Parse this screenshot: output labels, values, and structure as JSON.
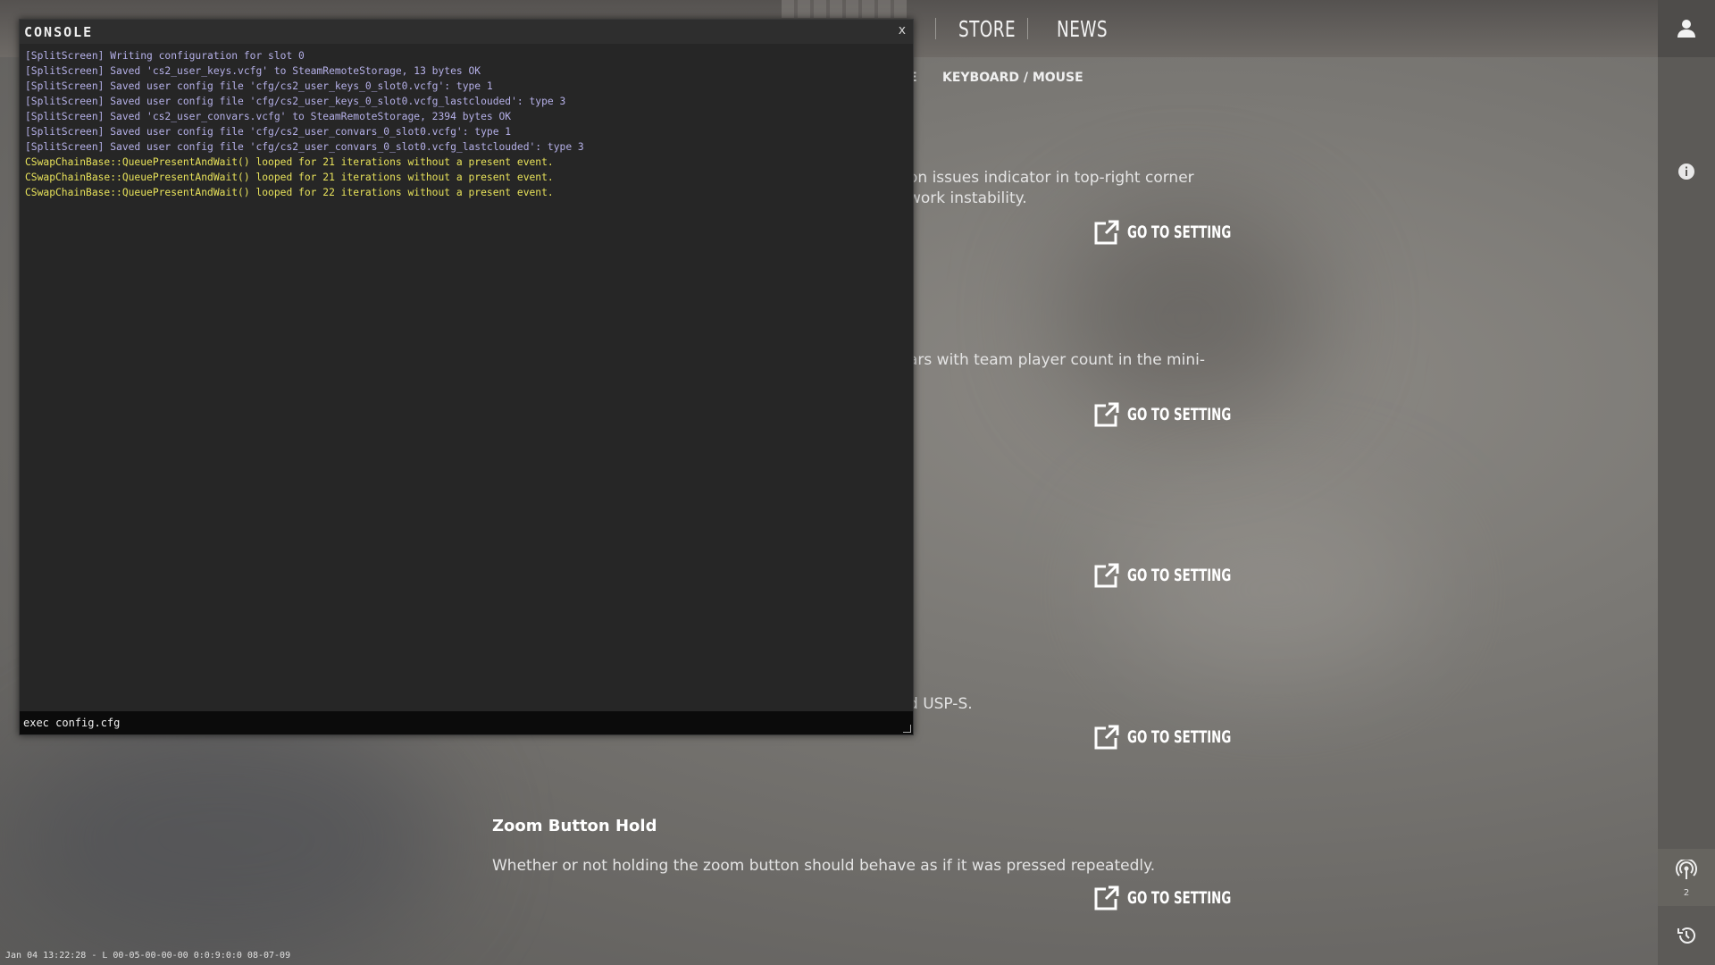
{
  "topnav": {
    "items": [
      {
        "label": "STORE"
      },
      {
        "label": "NEWS"
      }
    ]
  },
  "subnav": {
    "partial_label": "E",
    "active_label": "KEYBOARD / MOUSE"
  },
  "settings": [
    {
      "title": "",
      "desc_lines": [
        "on issues indicator in top-right corner",
        "work instability."
      ],
      "goto_label": "GO TO SETTING"
    },
    {
      "title": "",
      "desc_lines": [
        "ars with team player count in the mini-"
      ],
      "goto_label": "GO TO SETTING"
    },
    {
      "title": "",
      "desc_lines": [],
      "goto_label": "GO TO SETTING"
    },
    {
      "title": "",
      "desc_lines": [
        "d USP-S."
      ],
      "goto_label": "GO TO SETTING"
    },
    {
      "title": "Zoom Button Hold",
      "desc_lines": [
        "Whether or not holding the zoom button should behave as if it was pressed repeatedly."
      ],
      "goto_label": "GO TO SETTING"
    }
  ],
  "rightbar": {
    "broadcast_count": "2"
  },
  "console": {
    "title": "CONSOLE",
    "close_label": "x",
    "log": [
      {
        "level": "info",
        "text": "[SplitScreen] Writing configuration for slot 0"
      },
      {
        "level": "info",
        "text": "[SplitScreen] Saved 'cs2_user_keys.vcfg' to SteamRemoteStorage, 13 bytes OK"
      },
      {
        "level": "info",
        "text": "[SplitScreen] Saved user config file 'cfg/cs2_user_keys_0_slot0.vcfg': type 1"
      },
      {
        "level": "info",
        "text": "[SplitScreen] Saved user config file 'cfg/cs2_user_keys_0_slot0.vcfg_lastclouded': type 3"
      },
      {
        "level": "info",
        "text": "[SplitScreen] Saved 'cs2_user_convars.vcfg' to SteamRemoteStorage, 2394 bytes OK"
      },
      {
        "level": "info",
        "text": "[SplitScreen] Saved user config file 'cfg/cs2_user_convars_0_slot0.vcfg': type 1"
      },
      {
        "level": "info",
        "text": "[SplitScreen] Saved user config file 'cfg/cs2_user_convars_0_slot0.vcfg_lastclouded': type 3"
      },
      {
        "level": "warn",
        "text": "CSwapChainBase::QueuePresentAndWait() looped for 21 iterations without a present event."
      },
      {
        "level": "warn",
        "text": "CSwapChainBase::QueuePresentAndWait() looped for 21 iterations without a present event."
      },
      {
        "level": "warn",
        "text": "CSwapChainBase::QueuePresentAndWait() looped for 22 iterations without a present event."
      }
    ],
    "input_value": "exec config.cfg"
  },
  "statusline": "Jan 04 13:22:28 - L 00-05-00-00-00 0:0:9:0:0 08-07-09",
  "colors": {
    "log_info": "#b5b0e8",
    "log_warn": "#e8e25a",
    "console_bg": "#262626"
  }
}
